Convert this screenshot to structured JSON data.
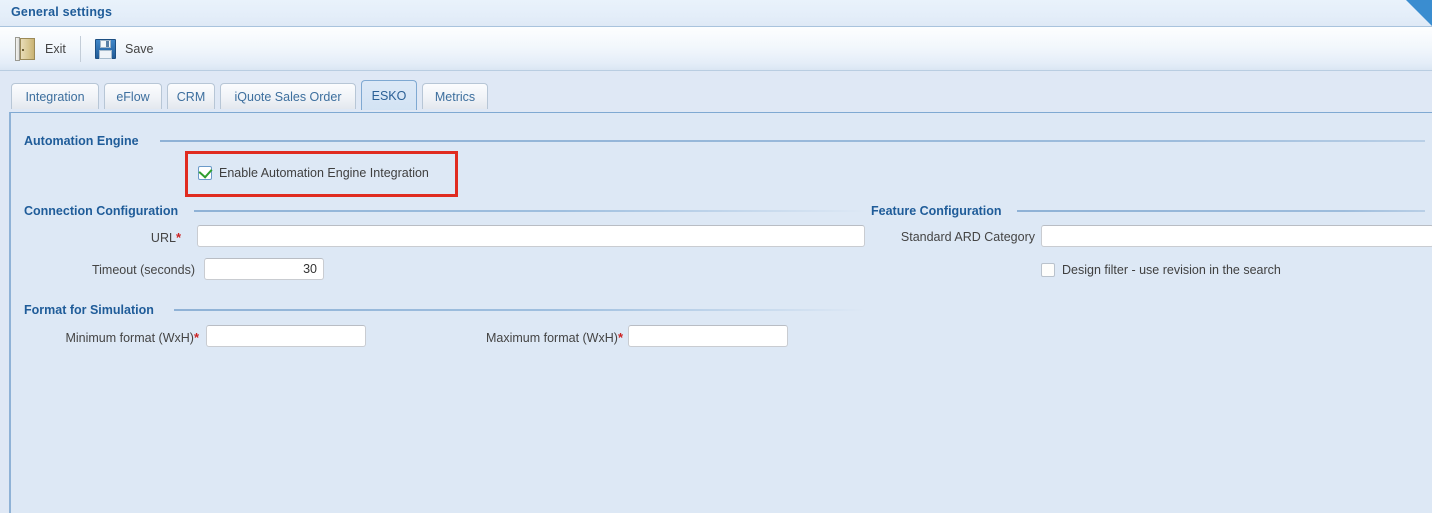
{
  "window": {
    "title": "General settings"
  },
  "toolbar": {
    "exit_label": "Exit",
    "save_label": "Save"
  },
  "tabs": [
    {
      "label": "Integration",
      "active": false
    },
    {
      "label": "eFlow",
      "active": false
    },
    {
      "label": "CRM",
      "active": false
    },
    {
      "label": "iQuote Sales Order",
      "active": false
    },
    {
      "label": "ESKO",
      "active": true
    },
    {
      "label": "Metrics",
      "active": false
    }
  ],
  "groups": {
    "automation_engine": {
      "title": "Automation Engine",
      "enable_checkbox": {
        "label": "Enable Automation Engine Integration",
        "checked": true
      }
    },
    "connection_configuration": {
      "title": "Connection Configuration",
      "url": {
        "label": "URL",
        "required": "*",
        "value": "",
        "placeholder": ""
      },
      "timeout": {
        "label": "Timeout (seconds)",
        "value": "30",
        "placeholder": ""
      }
    },
    "feature_configuration": {
      "title": "Feature Configuration",
      "standard_ard_category": {
        "label": "Standard ARD Category",
        "value": "",
        "placeholder": ""
      },
      "design_filter": {
        "label": "Design filter - use revision in the search",
        "checked": false
      }
    },
    "format_for_simulation": {
      "title": "Format for Simulation",
      "minimum_format": {
        "label": "Minimum format (WxH)",
        "required": "*",
        "value": "",
        "placeholder": ""
      },
      "maximum_format": {
        "label": "Maximum format (WxH)",
        "required": "*",
        "value": "",
        "placeholder": ""
      }
    }
  },
  "colors": {
    "accent_blue": "#1f5c99",
    "panel_background": "#dde8f5",
    "annotation_red": "#e02b20",
    "check_green": "#2f9e2f",
    "required_red": "#cc2222"
  }
}
